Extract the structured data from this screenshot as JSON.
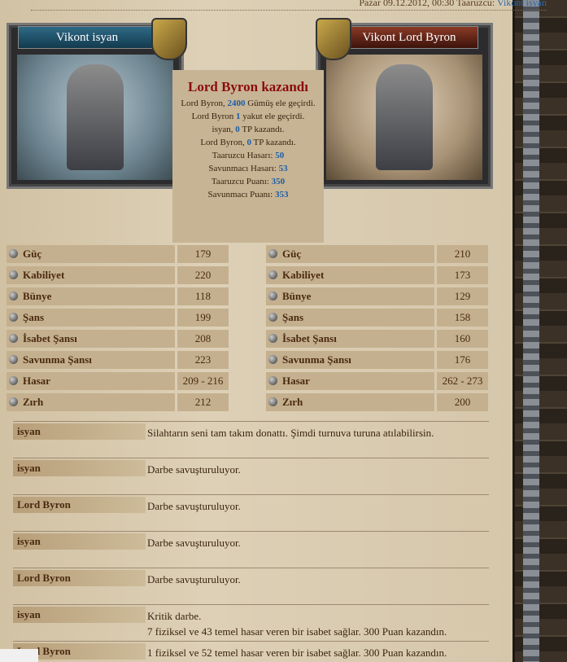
{
  "header": {
    "date": "Pazar 09.12.2012, 00:30",
    "attacker_label": "Taaruzcu:",
    "attacker_name": "Vikont isyan"
  },
  "left_fighter": {
    "name": "Vikont isyan"
  },
  "right_fighter": {
    "name": "Vikont Lord Byron"
  },
  "result": {
    "title": "Lord Byron kazandı",
    "l1a": "Lord Byron, ",
    "l1b": "2400",
    "l1c": " Gümüş ele geçirdi.",
    "l2a": "Lord Byron ",
    "l2b": "1",
    "l2c": " yakut ele geçirdi.",
    "l3a": "isyan, ",
    "l3b": "0",
    "l3c": " TP kazandı.",
    "l4a": "Lord Byron, ",
    "l4b": "0",
    "l4c": " TP kazandı.",
    "l5a": "Taaruzcu Hasarı: ",
    "l5b": "50",
    "l6a": "Savunmacı Hasarı: ",
    "l6b": "53",
    "l7a": "Taaruzcu Puanı: ",
    "l7b": "350",
    "l8a": "Savunmacı Puanı: ",
    "l8b": "353"
  },
  "stats": {
    "labels": [
      "Güç",
      "Kabiliyet",
      "Bünye",
      "Şans",
      "İsabet Şansı",
      "Savunma Şansı",
      "Hasar",
      "Zırh"
    ],
    "left": [
      "179",
      "220",
      "118",
      "199",
      "208",
      "223",
      "209 - 216",
      "212"
    ],
    "right": [
      "210",
      "173",
      "129",
      "158",
      "160",
      "176",
      "262 - 273",
      "200"
    ]
  },
  "log": [
    {
      "who": "isyan",
      "text": "Silahtarın seni tam takım donattı. Şimdi turnuva turuna atılabilirsin."
    },
    {
      "who": "isyan",
      "text": "Darbe savuşturuluyor."
    },
    {
      "who": "Lord Byron",
      "text": "Darbe savuşturuluyor."
    },
    {
      "who": "isyan",
      "text": "Darbe savuşturuluyor."
    },
    {
      "who": "Lord Byron",
      "text": "Darbe savuşturuluyor."
    },
    {
      "who": "isyan",
      "text": "Kritik darbe.",
      "text2": "7 fiziksel ve 43 temel hasar veren bir isabet sağlar. 300 Puan kazandın."
    },
    {
      "who": "Lord Byron",
      "text": "1 fiziksel ve 52 temel hasar veren bir isabet sağlar. 300 Puan kazandın."
    }
  ]
}
